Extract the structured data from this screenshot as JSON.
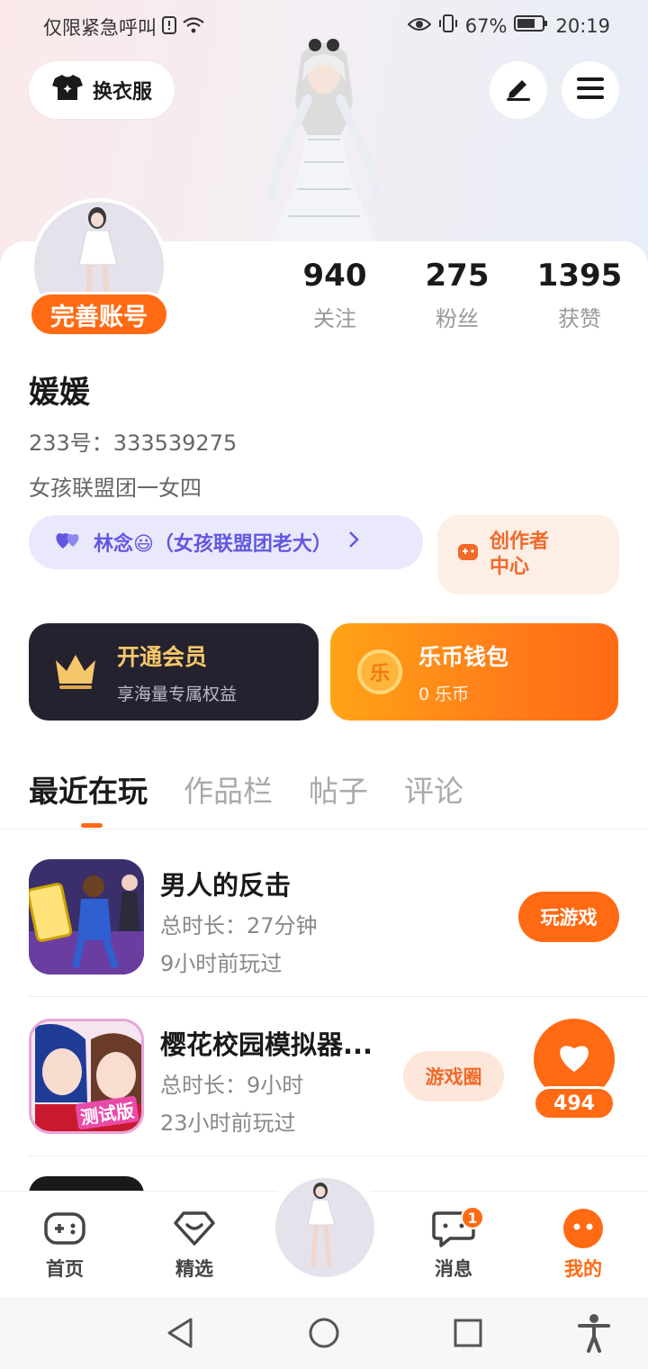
{
  "status_bar": {
    "carrier_text": "仅限紧急呼叫",
    "battery": "67%",
    "time": "20:19"
  },
  "header": {
    "outfit_label": "换衣服"
  },
  "profile": {
    "complete_badge": "完善账号",
    "stats": [
      {
        "value": "940",
        "label": "关注"
      },
      {
        "value": "275",
        "label": "粉丝"
      },
      {
        "value": "1395",
        "label": "获赞"
      }
    ],
    "nickname": "媛媛",
    "uid": "233号：333539275",
    "bio": "女孩联盟团一女四",
    "relation": "林念😃（女孩联盟团老大）",
    "creator_line1": "创作者",
    "creator_line2": "中心"
  },
  "vip_card": {
    "title": "开通会员",
    "subtitle": "享海量专属权益"
  },
  "coin_card": {
    "icon_char": "乐",
    "title": "乐币钱包",
    "subtitle": "0 乐币"
  },
  "tabs": [
    "最近在玩",
    "作品栏",
    "帖子",
    "评论"
  ],
  "games": [
    {
      "name": "男人的反击",
      "duration": "总时长：27分钟",
      "last_played": "9小时前玩过",
      "action": "玩游戏"
    },
    {
      "name": "樱花校园模拟器...",
      "duration": "总时长：9小时",
      "last_played": "23小时前玩过",
      "action": "游戏圈",
      "icon_badge": "测试版"
    }
  ],
  "like_float": {
    "count": "494"
  },
  "bottom_nav": [
    {
      "label": "首页"
    },
    {
      "label": "精选"
    },
    {
      "label": "消息",
      "badge": "1"
    },
    {
      "label": "我的"
    }
  ],
  "colors": {
    "accent": "#ff6a13",
    "vip_bg": "#24222e",
    "vip_gold": "#f5c76b",
    "relation_text": "#6258e0"
  }
}
